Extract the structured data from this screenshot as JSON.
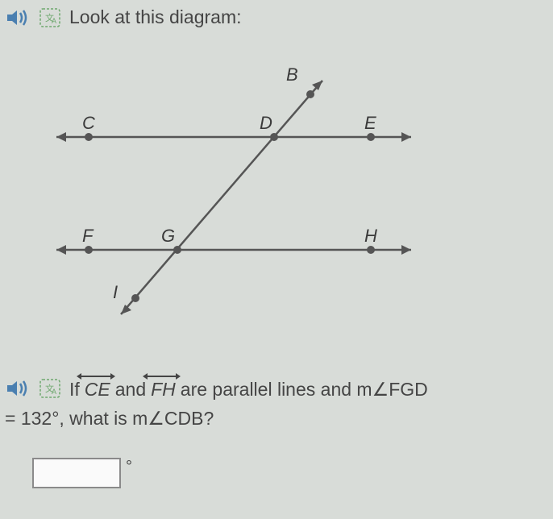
{
  "instruction": "Look at this diagram:",
  "question": {
    "prefix": "If",
    "line1": "CE",
    "mid1": "and",
    "line2": "FH",
    "mid2": "are parallel lines and m∠FGD",
    "cont": "= 132°, what is m∠CDB?"
  },
  "diagram": {
    "points": {
      "B": "B",
      "C": "C",
      "D": "D",
      "E": "E",
      "F": "F",
      "G": "G",
      "H": "H",
      "I": "I"
    }
  },
  "answer": {
    "value": "",
    "unit": "°"
  },
  "icons": {
    "speaker": "speaker",
    "translate": "translate"
  }
}
